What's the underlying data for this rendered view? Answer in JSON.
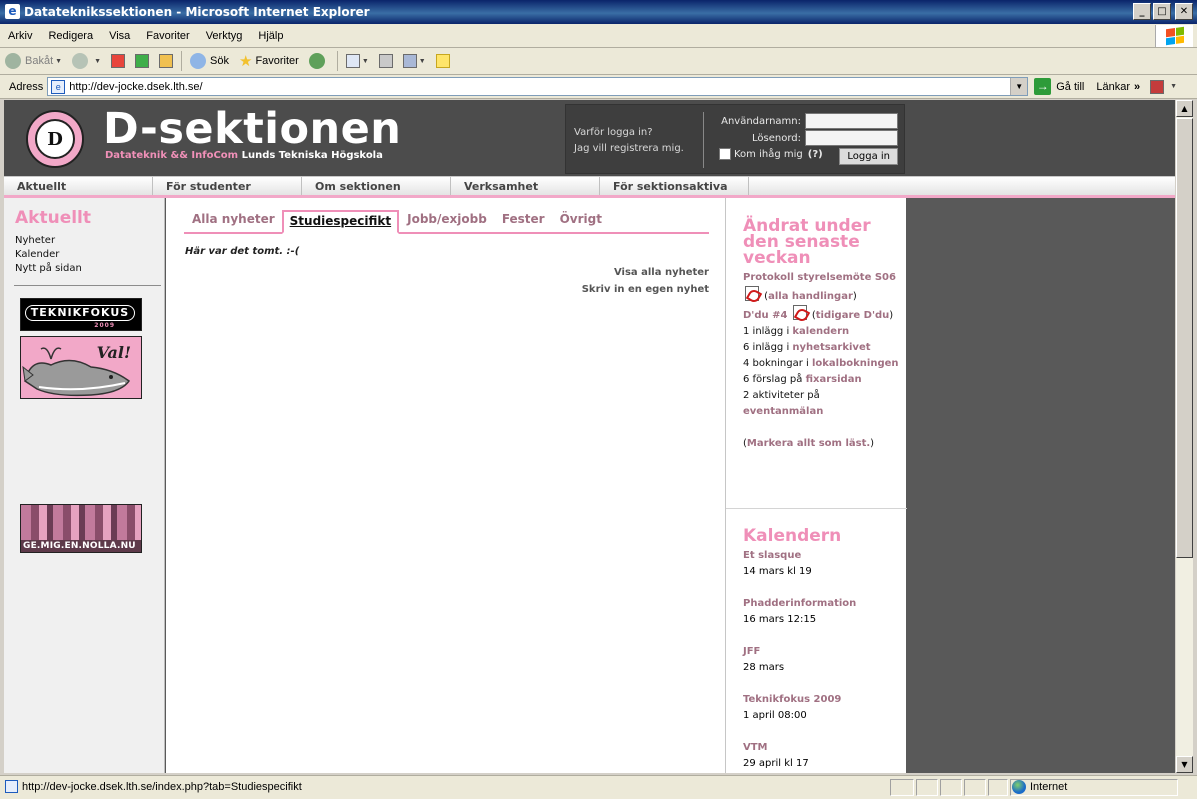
{
  "window": {
    "title": "Datateknikssektionen - Microsoft Internet Explorer"
  },
  "menu": [
    "Arkiv",
    "Redigera",
    "Visa",
    "Favoriter",
    "Verktyg",
    "Hjälp"
  ],
  "toolbar": {
    "back": "Bakåt",
    "search": "Sök",
    "favorites": "Favoriter"
  },
  "address": {
    "label": "Adress",
    "url": "http://dev-jocke.dsek.lth.se/",
    "go": "Gå till",
    "links": "Länkar"
  },
  "site": {
    "title": "D-sektionen",
    "subtitle_pink": "Datateknik && InfoCom",
    "subtitle_white": "Lunds Tekniska Högskola",
    "seal_text": "D"
  },
  "login": {
    "why": "Varför logga in?",
    "register": "Jag vill registrera mig.",
    "username_label": "Användarnamn:",
    "password_label": "Lösenord:",
    "remember": "Kom ihåg mig",
    "help": "(?)",
    "button": "Logga in"
  },
  "nav": [
    "Aktuellt",
    "För studenter",
    "Om sektionen",
    "Verksamhet",
    "För sektionsaktiva"
  ],
  "left": {
    "heading": "Aktuellt",
    "links": [
      "Nyheter",
      "Kalender",
      "Nytt på sidan"
    ],
    "banners": {
      "teknikfokus": "TEKNIKFOKUS",
      "teknikfokus_year": "2009",
      "val": "Val!",
      "nolla": "GE.MIG.EN.NOLLA.NU"
    }
  },
  "main": {
    "tabs": [
      "Alla nyheter",
      "Studiespecifikt",
      "Jobb/exjobb",
      "Fester",
      "Övrigt"
    ],
    "active_tab": "Studiespecifikt",
    "empty_message": "Här var det tomt. :-(",
    "show_all": "Visa alla nyheter",
    "write_own": "Skriv in en egen nyhet"
  },
  "right": {
    "changes_heading": "Ändrat under den senaste veckan",
    "changes": {
      "protokoll": "Protokoll styrelsemöte S06",
      "alla_handlingar": "alla handlingar",
      "ddu": "D'du #4",
      "tidigare_ddu": "tidigare D'du",
      "row1_pre": "1 inlägg i",
      "row1_link": "kalendern",
      "row2_pre": "6 inlägg i",
      "row2_link": "nyhetsarkivet",
      "row3_pre": "4 bokningar i",
      "row3_link": "lokalbokningen",
      "row4_pre": "6 förslag på",
      "row4_link": "fixarsidan",
      "row5_pre": "2 aktiviteter på",
      "row5_link": "eventanmälan",
      "mark_read": "Markera allt som läst."
    },
    "calendar_heading": "Kalendern",
    "calendar": [
      {
        "title": "Et slasque",
        "date": "14 mars kl 19"
      },
      {
        "title": "Phadderinformation",
        "date": "16 mars 12:15"
      },
      {
        "title": "JFF",
        "date": "28 mars"
      },
      {
        "title": "Teknikfokus 2009",
        "date": "1 april 08:00"
      },
      {
        "title": "VTM",
        "date": "29 april kl 17"
      }
    ]
  },
  "status": {
    "url": "http://dev-jocke.dsek.lth.se/index.php?tab=Studiespecifikt",
    "zone": "Internet"
  },
  "colors": {
    "accent_pink": "#ef8fb8",
    "header_gray": "#4c4c4c",
    "link_mauve": "#a07082"
  }
}
